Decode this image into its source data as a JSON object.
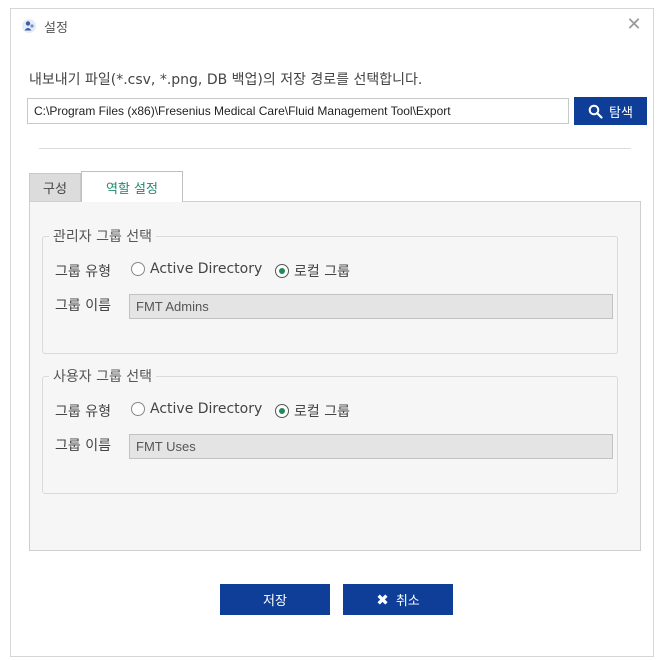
{
  "window": {
    "title": "설정",
    "icon": "app-people-icon",
    "close_icon": "close-icon"
  },
  "export": {
    "description": "내보내기 파일(*.csv, *.png, DB 백업)의 저장 경로를 선택합니다.",
    "path": "C:\\Program Files (x86)\\Fresenius Medical Care\\Fluid Management Tool\\Export",
    "browse_label": "탐색",
    "browse_icon": "search-icon"
  },
  "tabs": [
    {
      "label": "구성",
      "selected": false
    },
    {
      "label": "역할 설정",
      "selected": true
    }
  ],
  "admin_group": {
    "title": "관리자 그룹 선택",
    "type_label": "그룹 유형",
    "option_ad": "Active Directory",
    "option_local": "로컬 그룹",
    "selected": "local",
    "name_label": "그룹 이름",
    "name_value": "FMT Admins"
  },
  "user_group": {
    "title": "사용자 그룹 선택",
    "type_label": "그룹 유형",
    "option_ad": "Active Directory",
    "option_local": "로컬 그룹",
    "selected": "local",
    "name_label": "그룹 이름",
    "name_value": "FMT Uses"
  },
  "buttons": {
    "save_label": "저장",
    "cancel_label": "취소",
    "cancel_icon": "x-icon"
  },
  "colors": {
    "accent": "#0f3e99",
    "tab_active_text": "#1f8a70",
    "radio_selected": "#1f8a55"
  }
}
